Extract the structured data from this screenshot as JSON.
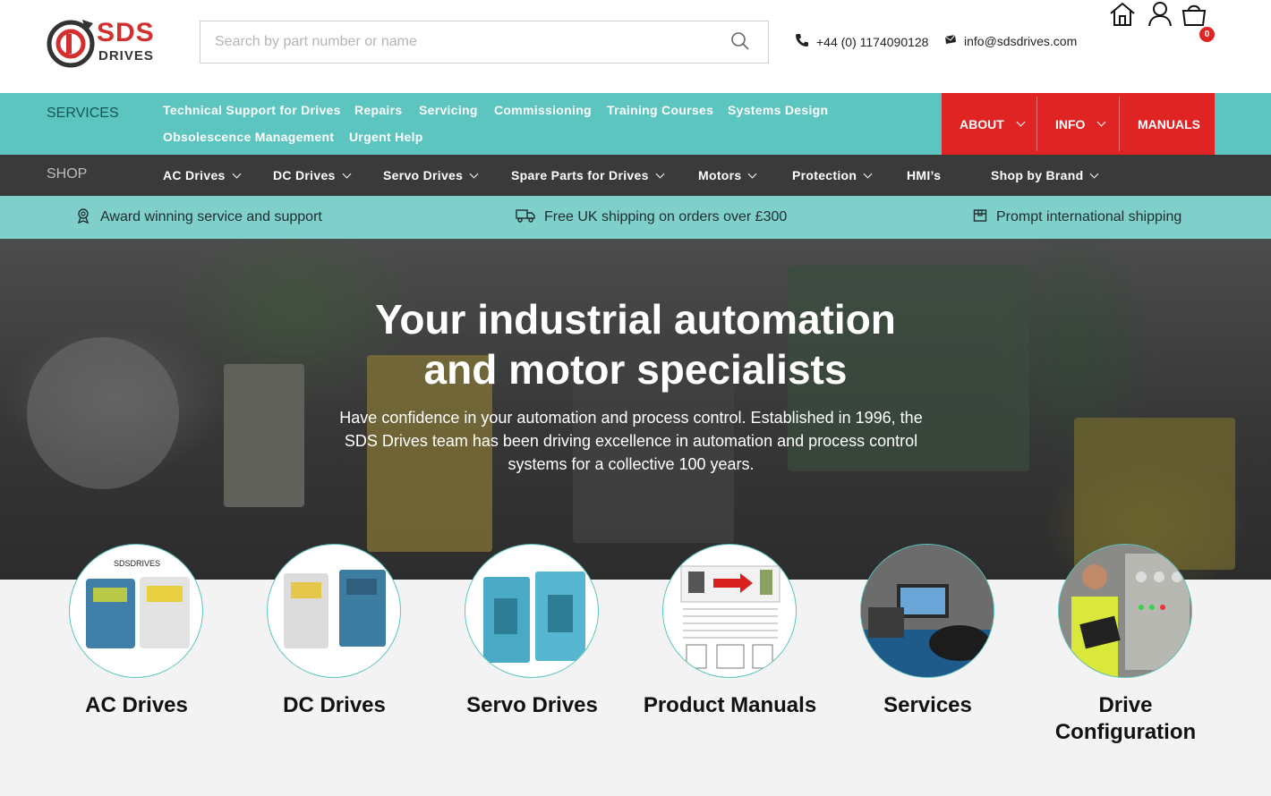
{
  "header": {
    "logo_text_main": "SDS",
    "logo_text_sub": "DRIVES",
    "search_placeholder": "Search by part number or name",
    "phone": "+44 (0) 1174090128",
    "email": "info@sdsdrives.com",
    "cart_count": "0",
    "icons": [
      "phone-icon",
      "email-icon",
      "home-icon",
      "account-icon",
      "cart-icon",
      "search-icon"
    ]
  },
  "services": {
    "label": "SERVICES",
    "links": [
      "Technical Support for Drives",
      "Repairs",
      "Servicing",
      "Commissioning",
      "Training Courses",
      "Systems Design",
      "Obsolescence Management",
      "Urgent Help"
    ],
    "menu": [
      "ABOUT",
      "INFO",
      "MANUALS"
    ]
  },
  "shop": {
    "label": "SHOP",
    "links": [
      "AC Drives",
      "DC Drives",
      "Servo Drives",
      "Spare Parts for Drives",
      "Motors",
      "Protection",
      "HMI’s",
      "Shop by Brand"
    ]
  },
  "usp": {
    "items": [
      "Award winning service and support",
      "Free UK shipping on orders over £300",
      "Prompt international shipping"
    ]
  },
  "hero": {
    "title_line1": "Your industrial automation",
    "title_line2": "and motor specialists",
    "text": "Have confidence in your automation and process control. Established in 1996, the SDS Drives team has been driving excellence in automation and process control systems for a collective 100 years."
  },
  "categories": [
    {
      "name": "AC Drives",
      "logo": "SDSDRIVES"
    },
    {
      "name": "DC Drives"
    },
    {
      "name": "Servo Drives"
    },
    {
      "name": "Product Manuals"
    },
    {
      "name": "Services"
    },
    {
      "name": "Drive Configuration"
    }
  ],
  "colors": {
    "teal": "#5cc5bf",
    "red": "#e02424",
    "dark": "#3a3a3a",
    "usp": "#7fcfca"
  }
}
